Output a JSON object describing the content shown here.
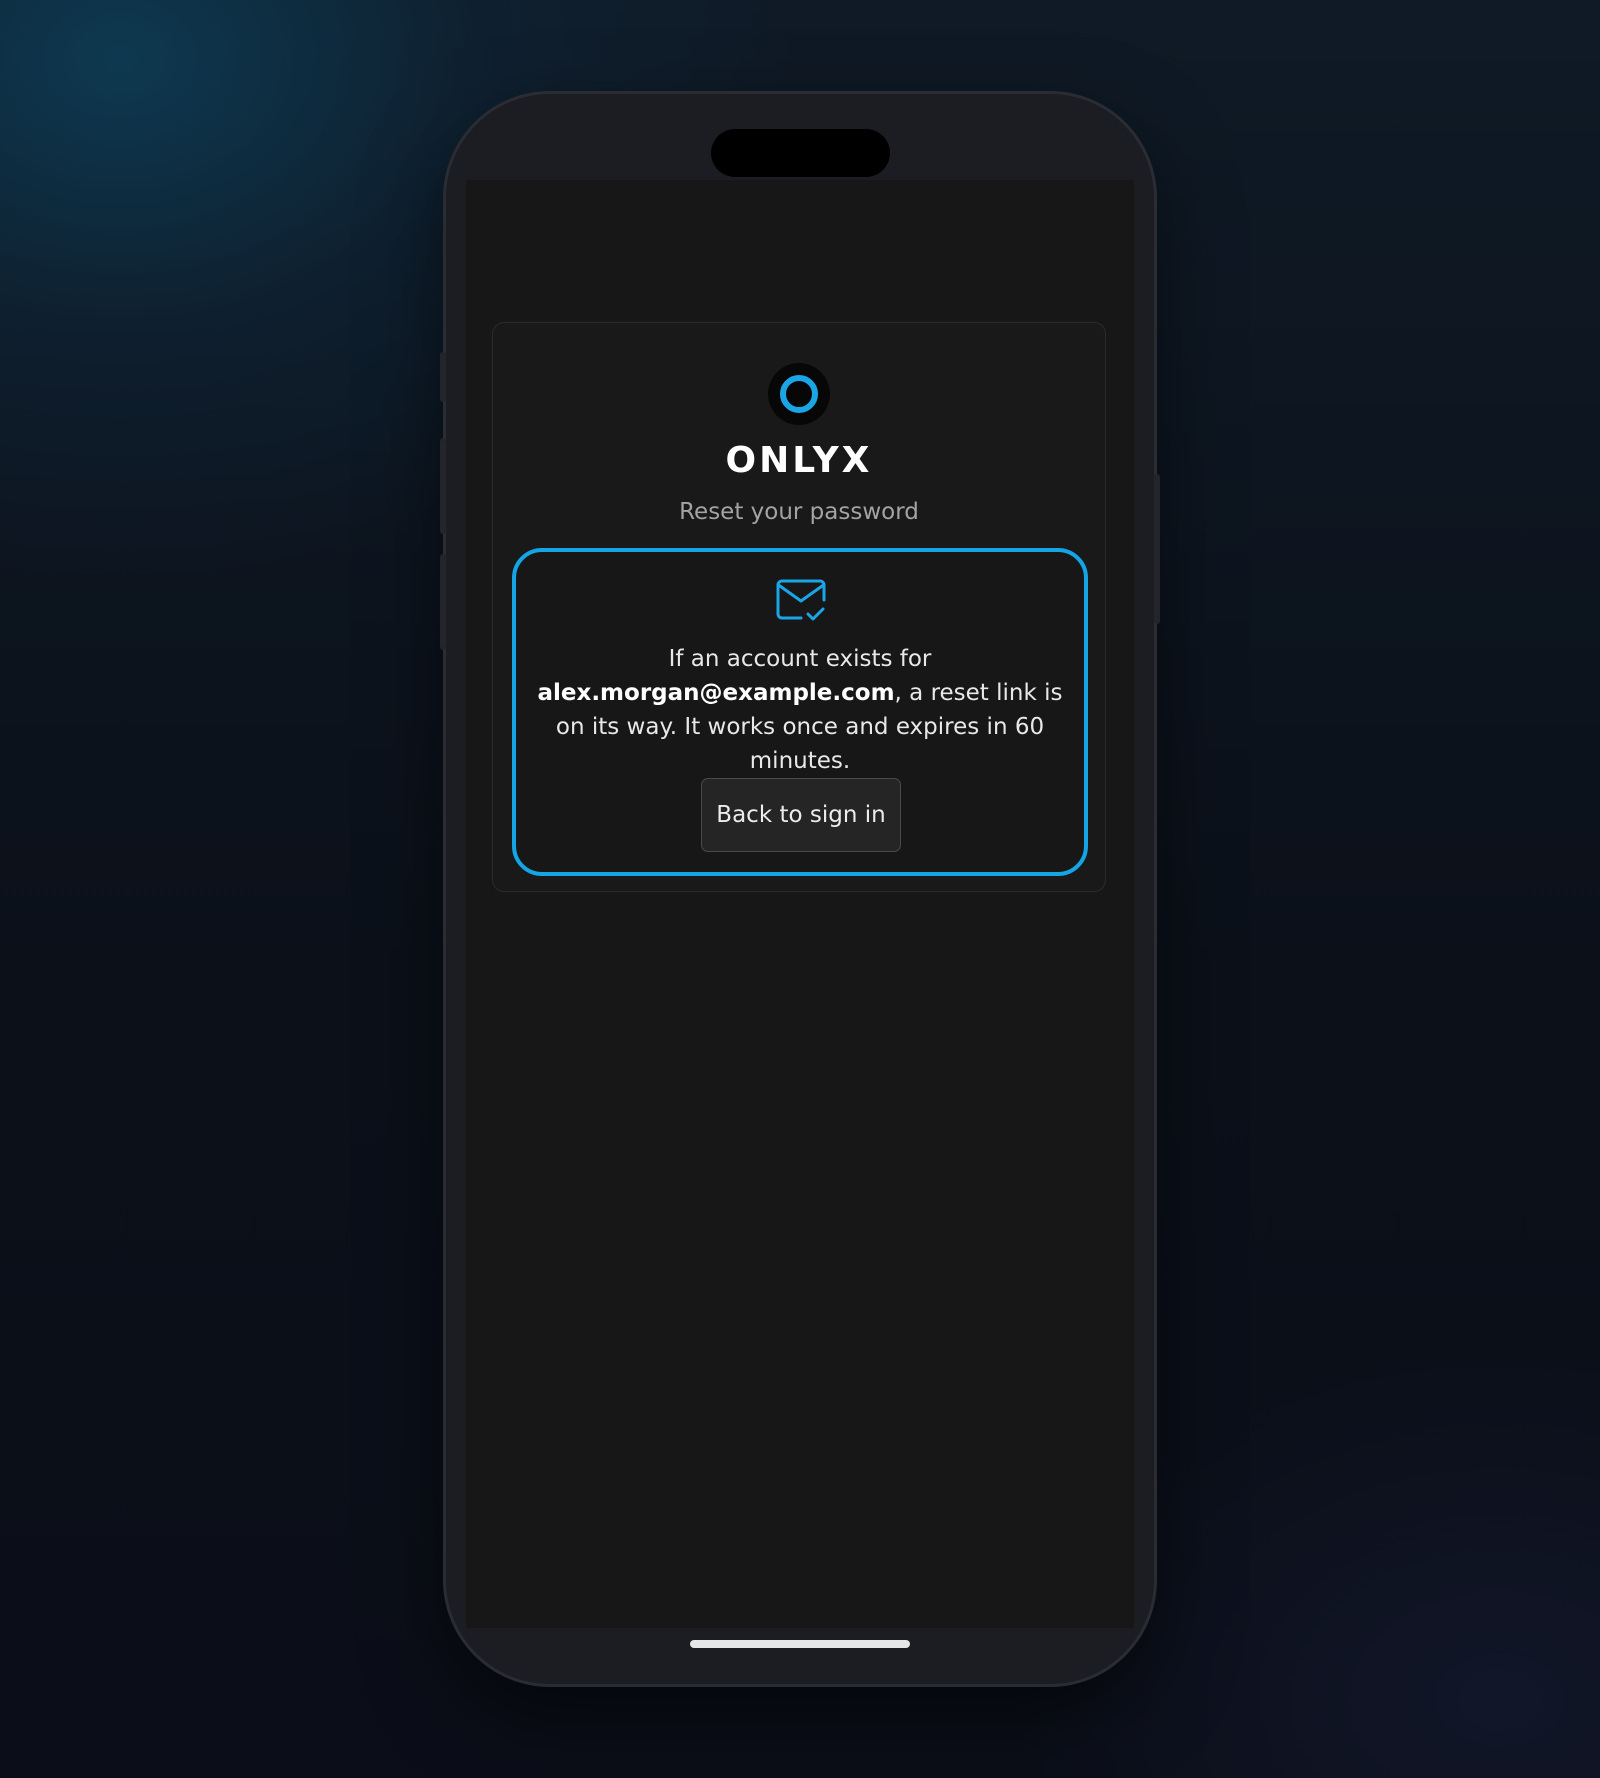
{
  "brand": {
    "name": "ONLYX",
    "accent_color": "#14a5e6"
  },
  "page": {
    "subtitle": "Reset your password"
  },
  "notice": {
    "icon": "mail-check-icon",
    "text_before": "If an account exists for ",
    "email": "alex.morgan@example.com",
    "text_after": ", a reset link is on its way. It works once and expires in 60 minutes.",
    "button_label": "Back to sign in"
  }
}
